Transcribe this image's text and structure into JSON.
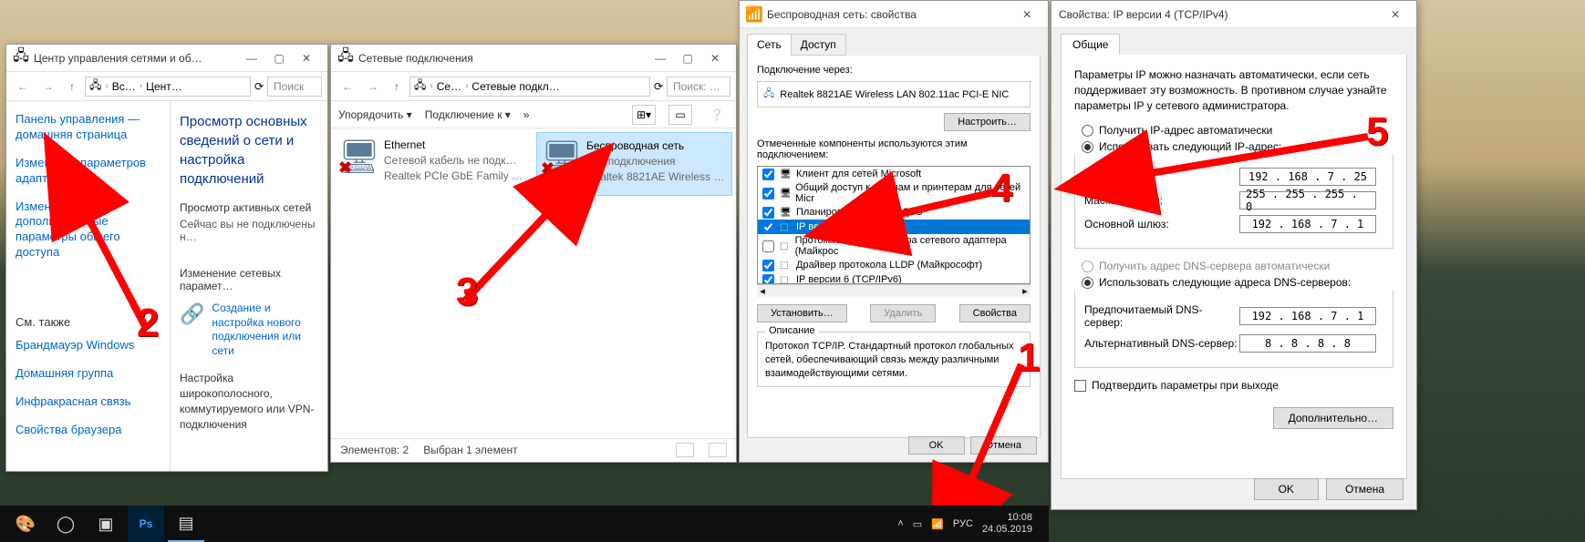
{
  "win1": {
    "title": "Центр управления сетями и об…",
    "breadcrumb": {
      "p1": "Вс…",
      "p2": "Цент…"
    },
    "search": "Поиск",
    "sidebar": {
      "home": "Панель управления — домашняя страница",
      "change_adapter": "Изменение параметров адаптера",
      "change_sharing": "Изменить дополнительные параметры общего доступа",
      "see_also": "См. также",
      "firewall": "Брандмауэр Windows",
      "homegroup": "Домашняя группа",
      "infrared": "Инфракрасная связь",
      "browser_props": "Свойства браузера"
    },
    "main": {
      "heading": "Просмотр основных сведений о сети и настройка подключений",
      "active_nets": "Просмотр активных сетей",
      "not_connected": "Сейчас вы не подключены н…",
      "change_params": "Изменение сетевых парамет…",
      "new_conn": "Создание и настройка нового подключения или сети",
      "desc": "Настройка широкополосного, коммутируемого или VPN-подключения"
    }
  },
  "win2": {
    "title": "Сетевые подключения",
    "breadcrumb": {
      "p1": "Се…",
      "p2": "Сетевые подкл…"
    },
    "search": "Поиск: …",
    "toolbar": {
      "organize": "Упорядочить",
      "connect": "Подключение к"
    },
    "adapters": [
      {
        "name": "Ethernet",
        "status": "Сетевой кабель не подк…",
        "device": "Realtek PCIe GbE Family …"
      },
      {
        "name": "Беспроводная сеть",
        "status": "Нет подключения",
        "device": "Realtek 8821AE Wireless …"
      }
    ],
    "status": {
      "count": "Элементов: 2",
      "selected": "Выбран 1 элемент"
    }
  },
  "win3": {
    "title": "Беспроводная сеть: свойства",
    "tab_net": "Сеть",
    "tab_access": "Доступ",
    "conn_via": "Подключение через:",
    "adapter": "Realtek 8821AE Wireless LAN 802.11ac PCI-E NIC",
    "configure": "Настроить…",
    "components_label": "Отмеченные компоненты используются этим подключением:",
    "components": [
      {
        "label": "Клиент для сетей Microsoft",
        "checked": true
      },
      {
        "label": "Общий доступ к файлам и принтерам для сетей Micr",
        "checked": true
      },
      {
        "label": "Планировщик пакетов QoS",
        "checked": true
      },
      {
        "label": "IP версии 4 (TCP/IPv4)",
        "checked": true,
        "selected": true
      },
      {
        "label": "Протокол мультиплексора сетевого адаптера (Майкрос",
        "checked": false
      },
      {
        "label": "Драйвер протокола LLDP (Майкрософт)",
        "checked": true
      },
      {
        "label": "IP версии 6 (TCP/IPv6)",
        "checked": true
      }
    ],
    "install": "Установить…",
    "remove": "Удалить",
    "properties": "Свойства",
    "desc_title": "Описание",
    "desc": "Протокол TCP/IP. Стандартный протокол глобальных сетей, обеспечивающий связь между различными взаимодействующими сетями.",
    "ok": "OK",
    "cancel": "Отмена"
  },
  "win4": {
    "title": "Свойства: IP версии 4 (TCP/IPv4)",
    "tab": "Общие",
    "info": "Параметры IP можно назначать автоматически, если сеть поддерживает эту возможность. В противном случае узнайте параметры IP у сетевого администратора.",
    "auto_ip": "Получить IP-адрес автоматически",
    "use_ip": "Использовать следующий IP-адрес:",
    "ip_label": "IP-адрес:",
    "ip_val": "192 . 168 .  7  . 25",
    "mask_label": "Маска подсети:",
    "mask_val": "255 . 255 . 255 .  0",
    "gw_label": "Основной шлюз:",
    "gw_val": "192 . 168 .  7  .  1",
    "auto_dns": "Получить адрес DNS-сервера автоматически",
    "use_dns": "Использовать следующие адреса DNS-серверов:",
    "dns1_label": "Предпочитаемый DNS-сервер:",
    "dns1_val": "192 . 168 .  7  .  1",
    "dns2_label": "Альтернативный DNS-сервер:",
    "dns2_val": " 8  .  8  .  8  .  8",
    "validate": "Подтвердить параметры при выходе",
    "advanced": "Дополнительно…",
    "ok": "OK",
    "cancel": "Отмена"
  },
  "tray": {
    "lang": "РУС",
    "time": "10:08",
    "date": "24.05.2019"
  },
  "annotations": {
    "n1": "1",
    "n2": "2",
    "n3": "3",
    "n4": "4",
    "n5": "5"
  }
}
